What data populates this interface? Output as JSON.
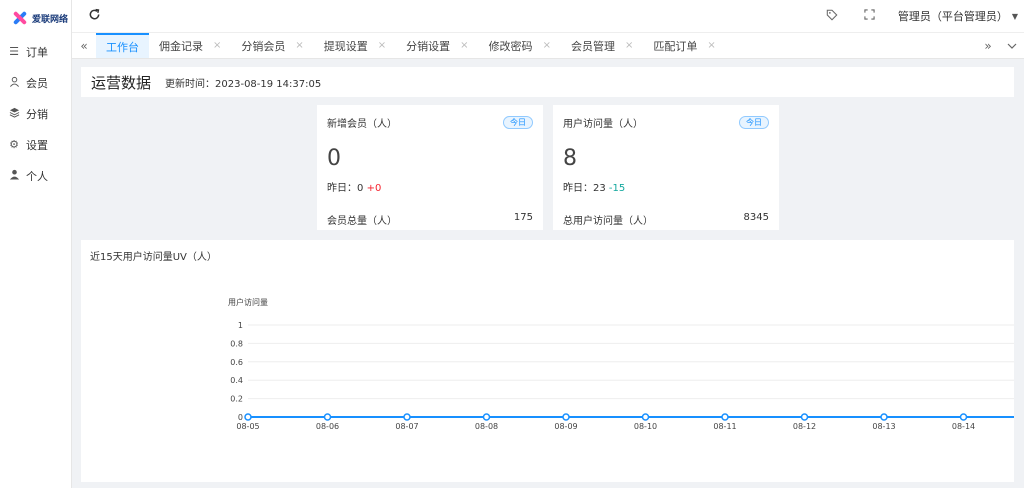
{
  "brand": {
    "logo_text": "爱联网络"
  },
  "sidebar": {
    "items": [
      {
        "label": "订单",
        "icon": "list-icon"
      },
      {
        "label": "会员",
        "icon": "user-outline-icon"
      },
      {
        "label": "分销",
        "icon": "layers-icon"
      },
      {
        "label": "设置",
        "icon": "gear-icon"
      },
      {
        "label": "个人",
        "icon": "person-icon"
      }
    ]
  },
  "header": {
    "user_label": "管理员（平台管理员）"
  },
  "tabs": [
    {
      "label": "工作台",
      "active": true
    },
    {
      "label": "佣金记录",
      "active": false
    },
    {
      "label": "分销会员",
      "active": false
    },
    {
      "label": "提现设置",
      "active": false
    },
    {
      "label": "分销设置",
      "active": false
    },
    {
      "label": "修改密码",
      "active": false
    },
    {
      "label": "会员管理",
      "active": false
    },
    {
      "label": "匹配订单",
      "active": false
    }
  ],
  "page": {
    "title": "运营数据",
    "update_time": "更新时间：2023-08-19 14:37:05"
  },
  "cards": [
    {
      "title": "新增会员（人）",
      "badge": "今日",
      "value": "0",
      "yesterday_label": "昨日：",
      "yesterday_value": "0",
      "delta": "+0",
      "footer_label": "会员总量（人）",
      "footer_value": "175"
    },
    {
      "title": "用户访问量（人）",
      "badge": "今日",
      "value": "8",
      "yesterday_label": "昨日：",
      "yesterday_value": "23",
      "delta": "-15",
      "footer_label": "总用户访问量（人）",
      "footer_value": "8345"
    }
  ],
  "colors": {
    "accent": "#1890ff",
    "up": "#f5222d",
    "down": "#13a89e"
  },
  "chart_data": {
    "type": "line",
    "title": "近15天用户访问量UV（人）",
    "ylabel": "用户访问量",
    "xlabel": "",
    "x": [
      "08-05",
      "08-06",
      "08-07",
      "08-08",
      "08-09",
      "08-10",
      "08-11",
      "08-12",
      "08-13",
      "08-14"
    ],
    "series": [
      {
        "values": [
          0,
          0,
          0,
          0,
          0,
          0,
          0,
          0,
          0,
          0
        ]
      }
    ],
    "ylim": [
      0,
      1
    ],
    "yticks": [
      "0",
      "0.2",
      "0.4",
      "0.6",
      "0.8",
      "1"
    ],
    "grid": true,
    "legend": "none"
  }
}
